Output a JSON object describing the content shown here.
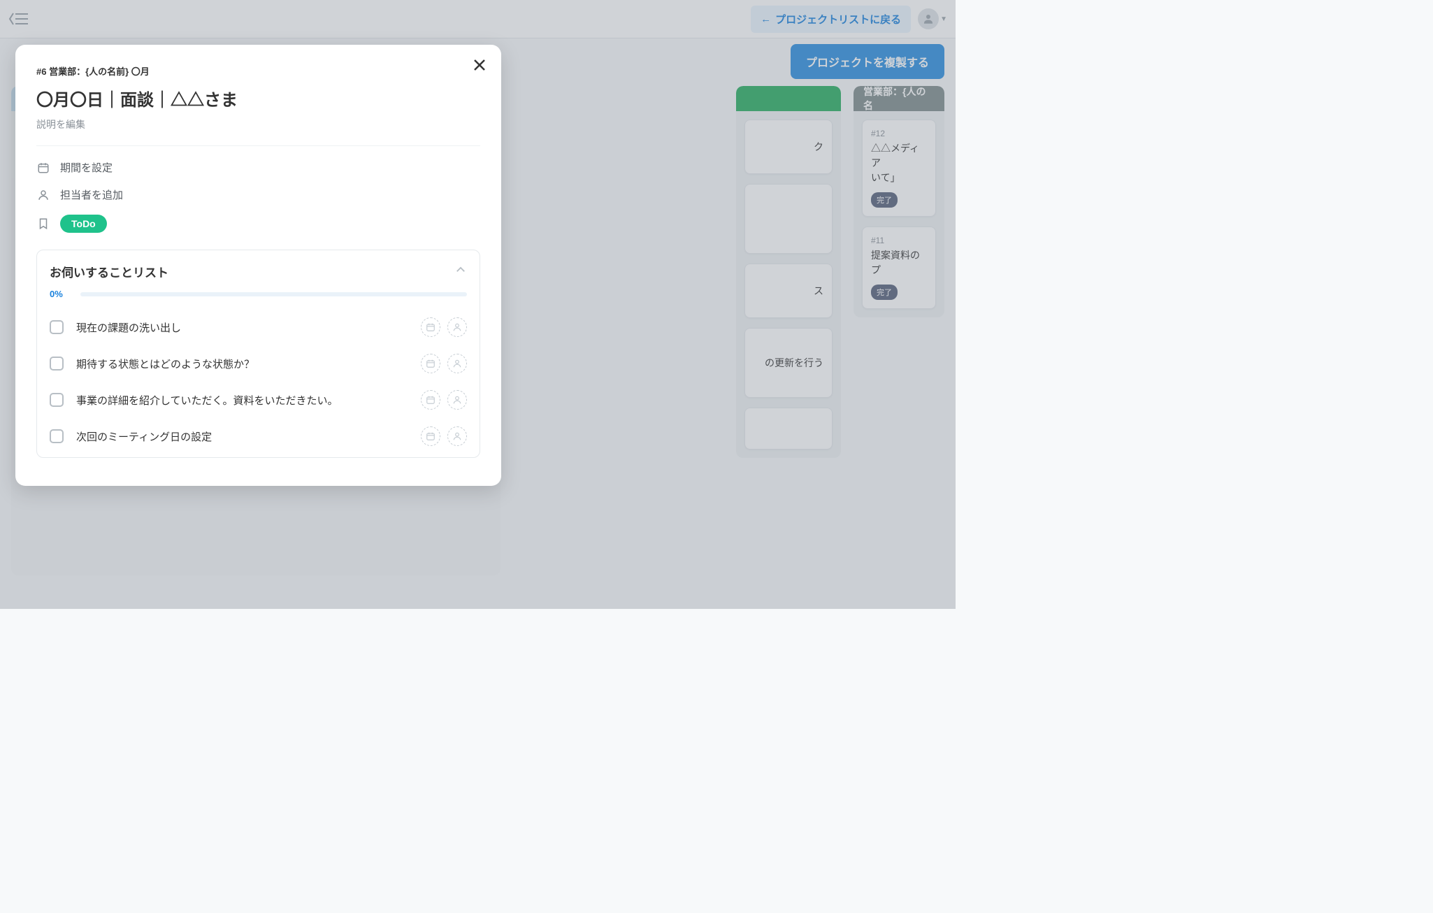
{
  "topbar": {
    "back_label": "プロジェクトリストに戻る"
  },
  "subbar": {
    "duplicate_label": "プロジェクトを複製する"
  },
  "bg_columns": {
    "col2_cards": [
      {
        "suffix": "ク"
      },
      {
        "suffix": "ス"
      },
      {
        "suffix": "の更新を行う"
      }
    ],
    "col3": {
      "title": "営業部：{人の名",
      "cards": [
        {
          "num": "#12",
          "title": "△△メディア\nいて」",
          "done": "完了"
        },
        {
          "num": "#11",
          "title": "提案資料のプ",
          "done": "完了"
        }
      ]
    }
  },
  "modal": {
    "breadcrumb": "#6 営業部：{人の名前} 〇月",
    "title": "〇月〇日｜面談｜△△さま",
    "edit_desc": "説明を編集",
    "meta": {
      "period": "期間を設定",
      "assignee": "担当者を追加",
      "status": "ToDo"
    },
    "checklist": {
      "title": "お伺いすることリスト",
      "progress": "0%",
      "items": [
        "現在の課題の洗い出し",
        "期待する状態とはどのような状態か？",
        "事業の詳細を紹介していただく。資料をいただきたい。",
        "次回のミーティング日の設定"
      ]
    }
  }
}
